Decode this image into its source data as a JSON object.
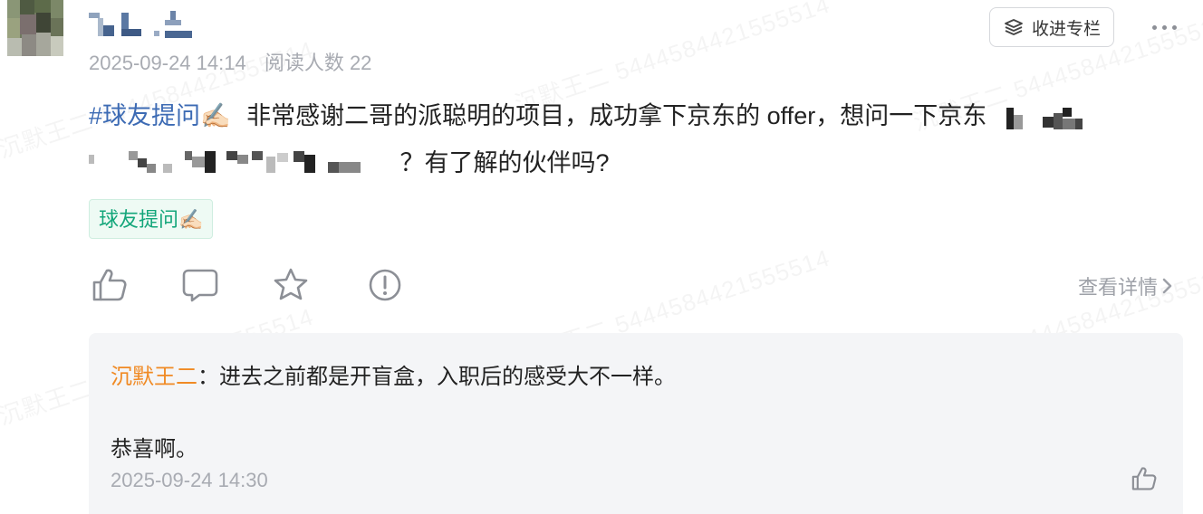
{
  "post": {
    "date": "2025-09-24 14:14",
    "reads": "阅读人数 22",
    "hashtag": "#球友提问✍🏻",
    "text_part1": "非常感谢二哥的派聪明的项目，成功拿下京东的 offer，想问一下京东",
    "text_part2": "？有了解的伙伴吗?",
    "topic_tag": "球友提问✍🏻"
  },
  "header": {
    "subscribe_label": "收进专栏",
    "subscribe_icon": "layers-icon",
    "more_icon": "more-dots-icon"
  },
  "actions": {
    "icons": [
      "thumbs-up-icon",
      "comment-icon",
      "star-icon",
      "report-icon"
    ],
    "detail_label": "查看详情"
  },
  "comment": {
    "author": "沉默王二",
    "separator": "：",
    "line1": "进去之前都是开盲盒，入职后的感受大不一样。",
    "line2": "恭喜啊。",
    "time": "2025-09-24 14:30"
  },
  "watermark": {
    "text": "沉默王二 5444584421555514"
  },
  "colors": {
    "hashtag": "#3d6bb4",
    "author": "#f08a24",
    "topic_tag_text": "#13a67a",
    "comment_bg": "#f4f5f7",
    "meta": "#a8abb2"
  }
}
